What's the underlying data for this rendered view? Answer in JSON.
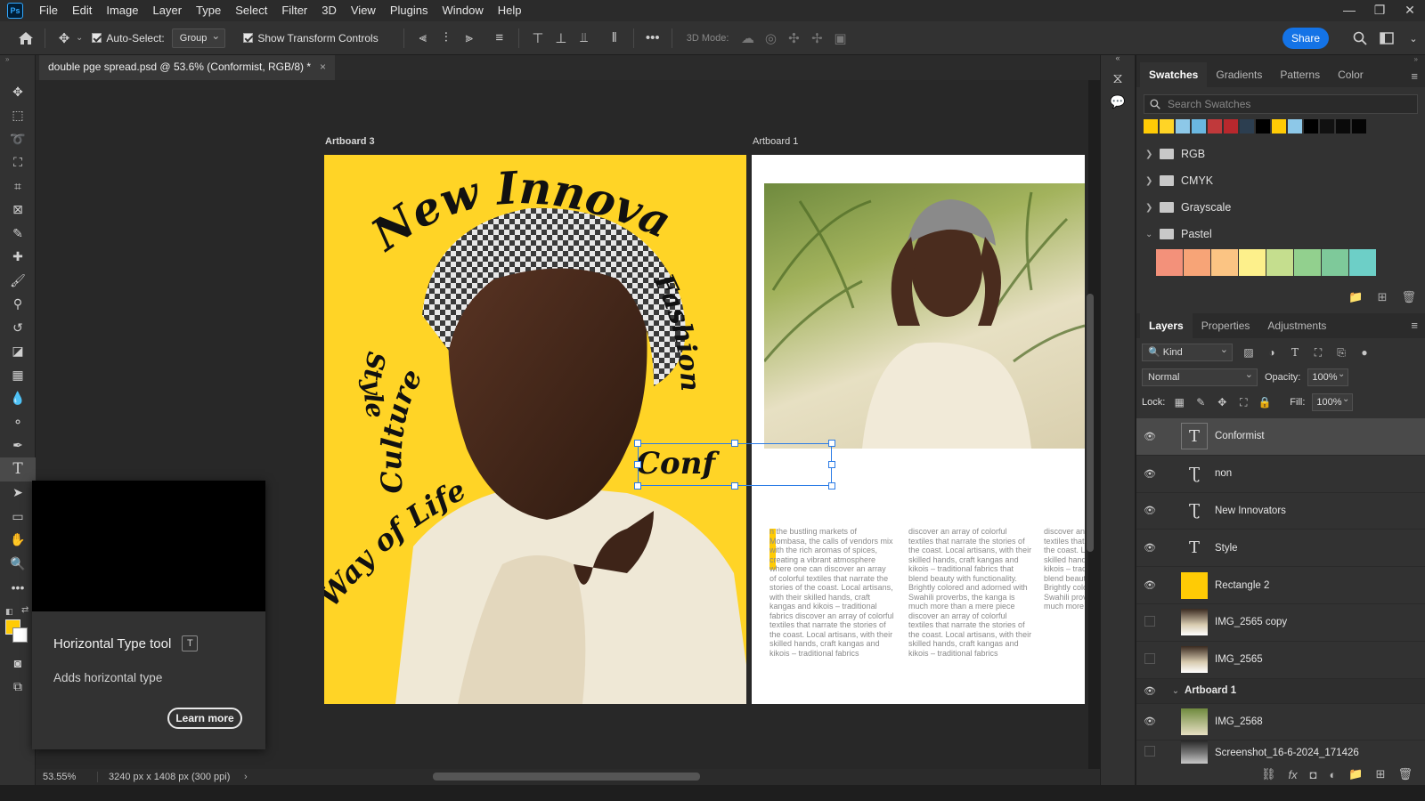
{
  "app": {
    "logo": "Ps"
  },
  "menu": [
    "File",
    "Edit",
    "Image",
    "Layer",
    "Type",
    "Select",
    "Filter",
    "3D",
    "View",
    "Plugins",
    "Window",
    "Help"
  ],
  "window_controls": {
    "minimize": "—",
    "restore": "❐",
    "close": "✕"
  },
  "options_bar": {
    "auto_select_label": "Auto-Select:",
    "auto_select_checked": true,
    "auto_select_target": "Group",
    "show_transform_label": "Show Transform Controls",
    "show_transform_checked": true,
    "mode_3d_label": "3D Mode:",
    "share_label": "Share"
  },
  "document": {
    "tab_title": "double pge spread.psd @ 53.6% (Conformist, RGB/8) *",
    "close_glyph": "×"
  },
  "artboards": [
    {
      "label": "Artboard 3"
    },
    {
      "label": "Artboard 1"
    }
  ],
  "artwork": {
    "headline": "New Innovators",
    "arc_words": [
      "Style",
      "Culture",
      "Way of Life",
      "Fashion",
      "Conformist"
    ],
    "conformist_visible": "Conf",
    "col1": "n the bustling markets of Mombasa, the calls of vendors mix with the rich aromas of spices, creating a vibrant atmosphere where one can discover an array of colorful textiles that narrate the stories of the coast. Local artisans, with their skilled hands, craft kangas and kikois – traditional fabrics discover an array of colorful textiles that narrate the stories of the coast. Local artisans, with their skilled hands, craft kangas and kikois – traditional fabrics",
    "col2": "discover an array of colorful textiles that narrate the stories of the coast. Local artisans, with their skilled hands, craft kangas and kikois – traditional fabrics that blend beauty with functionality. Brightly colored and adorned with Swahili proverbs, the kanga is much more than a mere piece discover an array of colorful textiles that narrate the stories of the coast. Local artisans, with their skilled hands, craft kangas and kikois – traditional fabrics",
    "col3": "discover an array of colorful textiles that narrate the stories of the coast. Local artisans, with their skilled hands, craft kangas and kikois – traditional fabrics that blend beauty with functionality. Brightly colored and adorned with Swahili proverbs, the kanga is much more than a mere piece"
  },
  "tooltip": {
    "title": "Horizontal Type tool",
    "shortcut": "T",
    "description": "Adds horizontal type",
    "learn_more": "Learn more"
  },
  "status_bar": {
    "zoom": "53.55%",
    "dimensions": "3240 px x 1408 px (300 ppi)",
    "arrow": "›"
  },
  "swatches_panel": {
    "tabs": [
      "Swatches",
      "Gradients",
      "Patterns",
      "Color"
    ],
    "active_tab": "Swatches",
    "search_placeholder": "Search Swatches",
    "recent_colors": [
      "#ffcb05",
      "#ffd426",
      "#8dc8e8",
      "#6ab7e0",
      "#c0393b",
      "#b8282d",
      "#2c3e50",
      "#000000",
      "#ffcb05",
      "#8dc8e8",
      "#000000",
      "#111111",
      "#0a0a0a",
      "#050505"
    ],
    "folders": [
      {
        "name": "RGB",
        "expanded": false
      },
      {
        "name": "CMYK",
        "expanded": false
      },
      {
        "name": "Grayscale",
        "expanded": false
      },
      {
        "name": "Pastel",
        "expanded": true
      }
    ],
    "pastel_colors": [
      "#f3917a",
      "#f7a477",
      "#fbc483",
      "#fdf08b",
      "#c5de8e",
      "#92d08e",
      "#7ec99a",
      "#6dcfc7"
    ]
  },
  "layers_panel": {
    "tabs": [
      "Layers",
      "Properties",
      "Adjustments"
    ],
    "active_tab": "Layers",
    "kind_label": "Kind",
    "blend_mode": "Normal",
    "opacity_label": "Opacity:",
    "opacity_value": "100%",
    "lock_label": "Lock:",
    "fill_label": "Fill:",
    "fill_value": "100%",
    "layers": [
      {
        "name": "Conformist",
        "type": "text",
        "visible": true,
        "selected": true
      },
      {
        "name": "non",
        "type": "warped-text",
        "visible": true,
        "selected": false
      },
      {
        "name": "New Innovators",
        "type": "warped-text",
        "visible": true,
        "selected": false
      },
      {
        "name": "Style",
        "type": "text",
        "visible": true,
        "selected": false
      },
      {
        "name": "Rectangle 2",
        "type": "shape",
        "visible": true,
        "selected": false
      },
      {
        "name": "IMG_2565 copy",
        "type": "image",
        "visible": false,
        "selected": false
      },
      {
        "name": "IMG_2565",
        "type": "image",
        "visible": false,
        "selected": false
      }
    ],
    "group": {
      "name": "Artboard 1",
      "visible": true,
      "expanded": true
    },
    "group_layers": [
      {
        "name": "IMG_2568",
        "type": "image",
        "visible": true
      },
      {
        "name": "Screenshot_16-6-2024_171426",
        "type": "screenshot",
        "visible": false
      }
    ]
  }
}
